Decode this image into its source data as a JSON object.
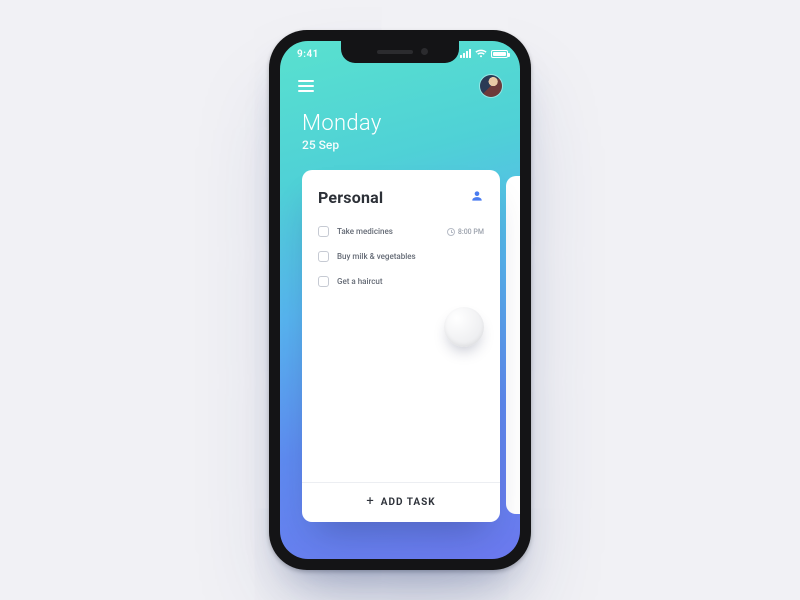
{
  "status": {
    "time": "9:41"
  },
  "header": {
    "day": "Monday",
    "date": "25 Sep"
  },
  "card": {
    "title": "Personal",
    "add_label": "ADD TASK",
    "tasks": [
      {
        "label": "Take medicines",
        "due": "8:00 PM"
      },
      {
        "label": "Buy milk & vegetables"
      },
      {
        "label": "Get a haircut"
      }
    ]
  }
}
